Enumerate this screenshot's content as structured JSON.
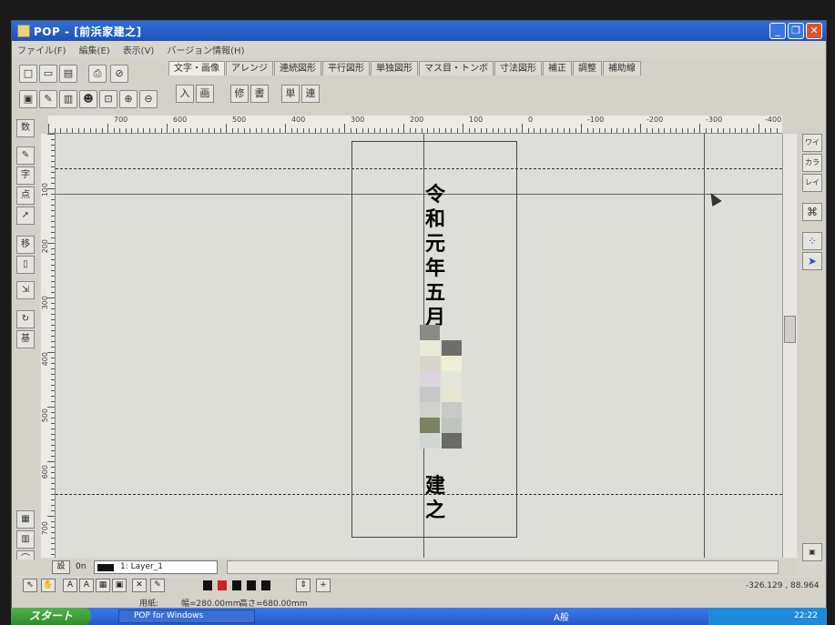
{
  "window": {
    "title": "POP - [前浜家建之]"
  },
  "menu": [
    "ファイル(F)",
    "編集(E)",
    "表示(V)",
    "バージョン情報(H)"
  ],
  "tabs": [
    "文字・画像",
    "アレンジ",
    "連続図形",
    "平行図形",
    "単独図形",
    "マス目・トンボ",
    "寸法図形",
    "補正",
    "調整",
    "補助線"
  ],
  "subtools": [
    "入",
    "画",
    "修",
    "書",
    "単",
    "連"
  ],
  "left_tools": [
    "数",
    "字",
    "点",
    "移",
    "基"
  ],
  "right_tools": [
    "ワイ",
    "カラ",
    "レイ"
  ],
  "ruler_top_labels": [
    "700",
    "600",
    "500",
    "400",
    "300",
    "200",
    "100",
    "0",
    "-100",
    "-200",
    "-300",
    "-400"
  ],
  "ruler_left_labels": [
    "100",
    "200",
    "300",
    "400",
    "500",
    "600",
    "700"
  ],
  "canvas_text": {
    "top_lines": [
      "令",
      "和",
      "元",
      "年",
      "五",
      "月"
    ],
    "bottom_lines": [
      "建",
      "之"
    ]
  },
  "layer": {
    "prefix": "0n",
    "name": "1: Layer_1"
  },
  "status": {
    "paper_label": "用紙:",
    "width": "幅=280.00mm",
    "height": "高さ=680.00mm",
    "coords": "-326.129 , 88.964"
  },
  "taskbar": {
    "start": "スタート",
    "task": "POP for Windows",
    "ime": "A般",
    "time": "22:22"
  }
}
